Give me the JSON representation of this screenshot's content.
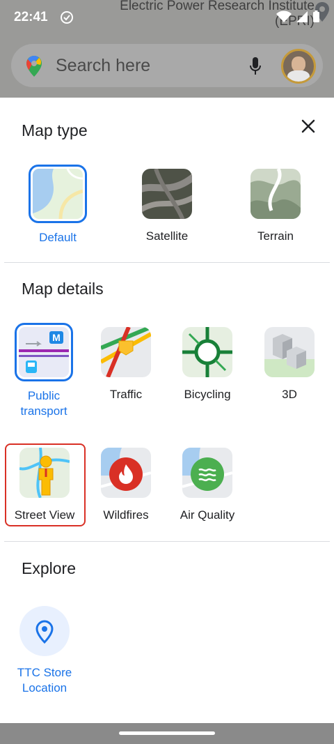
{
  "status": {
    "time": "22:41"
  },
  "map": {
    "place_label": "Electric Power Research Institute (EPRI)"
  },
  "search": {
    "placeholder": "Search here"
  },
  "sheet": {
    "map_type": {
      "title": "Map type",
      "items": [
        {
          "label": "Default",
          "selected": true
        },
        {
          "label": "Satellite",
          "selected": false
        },
        {
          "label": "Terrain",
          "selected": false
        }
      ]
    },
    "map_details": {
      "title": "Map details",
      "items": [
        {
          "label": "Public transport",
          "selected": true
        },
        {
          "label": "Traffic",
          "selected": false
        },
        {
          "label": "Bicycling",
          "selected": false
        },
        {
          "label": "3D",
          "selected": false
        },
        {
          "label": "Street View",
          "selected": false
        },
        {
          "label": "Wildfires",
          "selected": false
        },
        {
          "label": "Air Quality",
          "selected": false
        }
      ]
    },
    "explore": {
      "title": "Explore",
      "items": [
        {
          "label": "TTC Store Location"
        }
      ]
    }
  },
  "colors": {
    "accent": "#1a73e8",
    "highlight": "#d93025"
  }
}
